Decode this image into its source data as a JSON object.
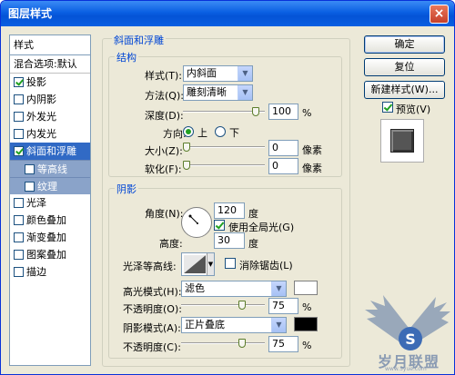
{
  "window": {
    "title": "图层样式",
    "close_glyph": "×"
  },
  "left_panel": {
    "header": "样式",
    "blend": "混合选项:默认",
    "items": [
      {
        "label": "投影",
        "checked": true
      },
      {
        "label": "内阴影",
        "checked": false
      },
      {
        "label": "外发光",
        "checked": false
      },
      {
        "label": "内发光",
        "checked": false
      },
      {
        "label": "斜面和浮雕",
        "checked": true,
        "selected": true
      },
      {
        "label": "等高线",
        "checked": false,
        "sub": true
      },
      {
        "label": "纹理",
        "checked": false,
        "sub": true
      },
      {
        "label": "光泽",
        "checked": false
      },
      {
        "label": "颜色叠加",
        "checked": false
      },
      {
        "label": "渐变叠加",
        "checked": false
      },
      {
        "label": "图案叠加",
        "checked": false
      },
      {
        "label": "描边",
        "checked": false
      }
    ]
  },
  "bevel": {
    "group_title": "斜面和浮雕",
    "structure": {
      "title": "结构",
      "style_label": "样式(T):",
      "style_value": "内斜面",
      "technique_label": "方法(Q):",
      "technique_value": "雕刻清晰",
      "depth_label": "深度(D):",
      "depth_value": "100",
      "depth_unit": "%",
      "depth_level": 0.93,
      "direction_label": "方向:",
      "direction_up": "上",
      "direction_down": "下",
      "size_label": "大小(Z):",
      "size_value": "0",
      "size_unit": "像素",
      "size_level": 0.0,
      "soften_label": "软化(F):",
      "soften_value": "0",
      "soften_unit": "像素",
      "soften_level": 0.0
    },
    "shading": {
      "title": "阴影",
      "angle_label": "角度(N):",
      "angle_value": "120",
      "angle_unit": "度",
      "global_light_label": "使用全局光(G)",
      "altitude_label": "高度:",
      "altitude_value": "30",
      "altitude_unit": "度",
      "gloss_contour_label": "光泽等高线:",
      "anti_alias_label": "消除锯齿(L)",
      "highlight_mode_label": "高光模式(H):",
      "highlight_mode_value": "滤色",
      "highlight_color": "#ffffff",
      "highlight_opacity_label": "不透明度(O):",
      "highlight_opacity_value": "75",
      "highlight_opacity_unit": "%",
      "highlight_opacity_level": 0.75,
      "shadow_mode_label": "阴影模式(A):",
      "shadow_mode_value": "正片叠底",
      "shadow_color": "#000000",
      "shadow_opacity_label": "不透明度(C):",
      "shadow_opacity_value": "75",
      "shadow_opacity_unit": "%",
      "shadow_opacity_level": 0.75
    }
  },
  "buttons": {
    "ok": "确定",
    "reset": "复位",
    "new_style": "新建样式(W)...",
    "preview_label": "预览(V)"
  },
  "watermark": {
    "text": "岁月联盟",
    "url": "www.5yue.com"
  }
}
